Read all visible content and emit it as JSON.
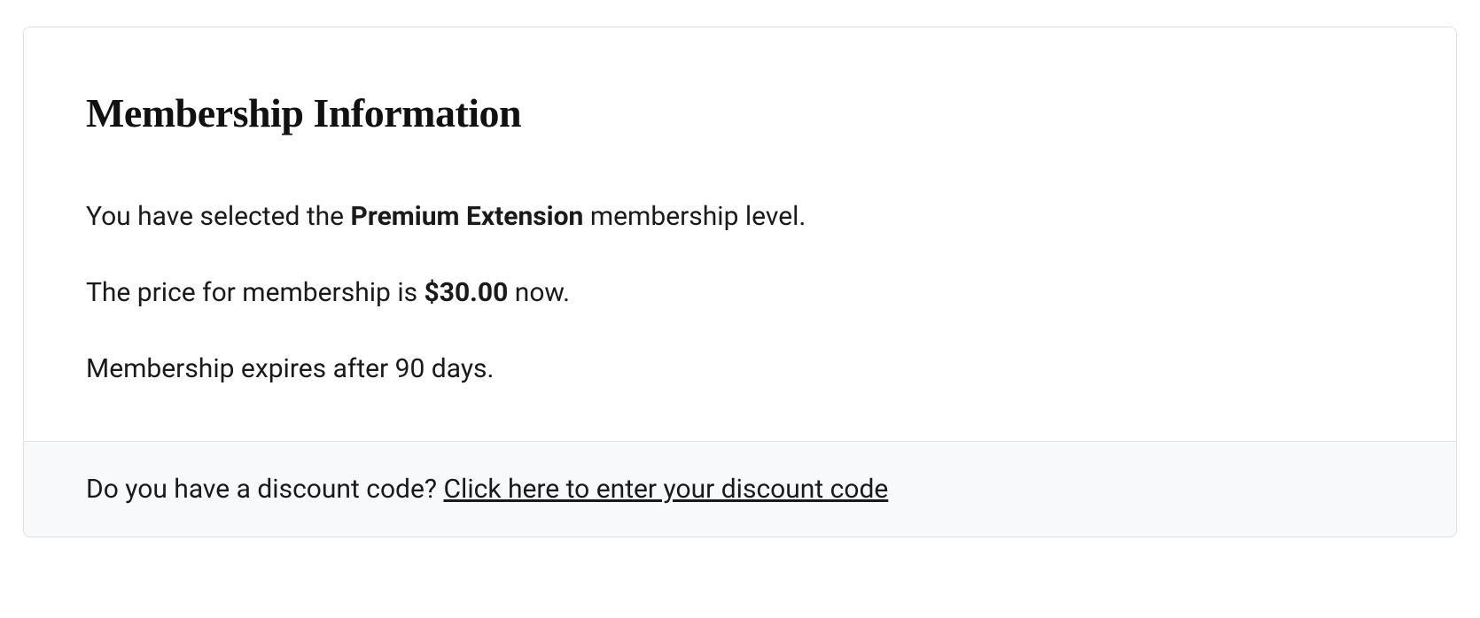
{
  "card": {
    "title": "Membership Information",
    "selected_prefix": "You have selected the ",
    "selected_level": "Premium Extension",
    "selected_suffix": " membership level.",
    "price_prefix": "The price for membership is ",
    "price_value": "$30.00",
    "price_suffix": " now.",
    "expires_text": "Membership expires after 90 days.",
    "discount_question": "Do you have a discount code? ",
    "discount_link": "Click here to enter your discount code"
  }
}
